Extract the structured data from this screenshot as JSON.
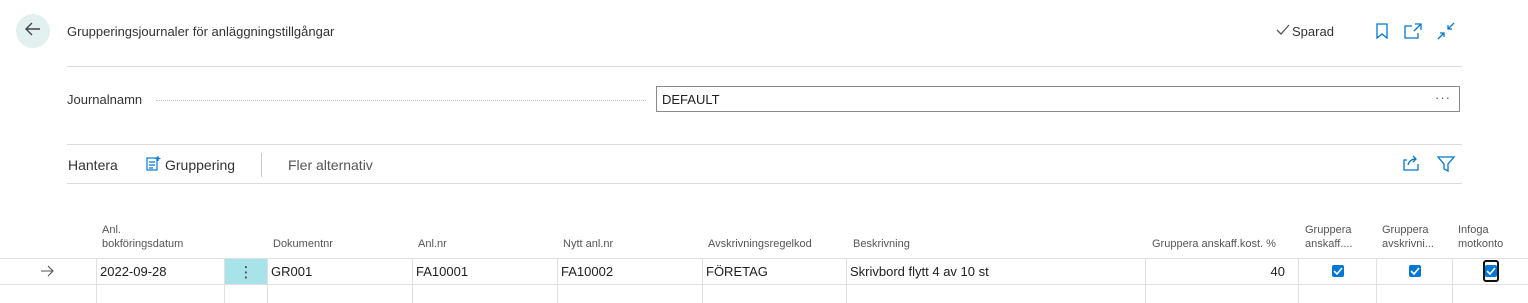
{
  "header": {
    "title": "Grupperingsjournaler för anläggningstillgångar",
    "saved_label": "Sparad",
    "icons": [
      "back-arrow-icon",
      "check-icon",
      "bookmark-icon",
      "open-new-window-icon",
      "collapse-icon"
    ]
  },
  "journal": {
    "label": "Journalnamn",
    "value": "DEFAULT",
    "more": "···"
  },
  "actions": {
    "manage": "Hantera",
    "grouping": "Gruppering",
    "more_options": "Fler alternativ"
  },
  "columns": {
    "posting_date_1": "Anl.",
    "posting_date_2": "bokföringsdatum",
    "document_no": "Dokumentnr",
    "fa_no": "Anl.nr",
    "new_fa_no": "Nytt anl.nr",
    "depreciation_code": "Avskrivningsregelkod",
    "description": "Beskrivning",
    "acq_cost_pct": "Gruppera anskaff.kost. %",
    "group_acq_1": "Gruppera",
    "group_acq_2": "anskaff....",
    "group_depr_1": "Gruppera",
    "group_depr_2": "avskrivni...",
    "insert_bal_1": "Infoga",
    "insert_bal_2": "motkonto"
  },
  "rows": [
    {
      "posting_date": "2022-09-28",
      "row_menu": "⋮",
      "document_no": "GR001",
      "fa_no": "FA10001",
      "new_fa_no": "FA10002",
      "depreciation_code": "FÖRETAG",
      "description": "Skrivbord flytt 4 av 10 st",
      "acq_cost_pct": "40",
      "group_acq": true,
      "group_depr": true,
      "insert_bal": true
    }
  ],
  "colors": {
    "accent": "#0078d4",
    "back_bg": "#e3f0f0",
    "menu_cell_bg": "#a8e3ea"
  }
}
